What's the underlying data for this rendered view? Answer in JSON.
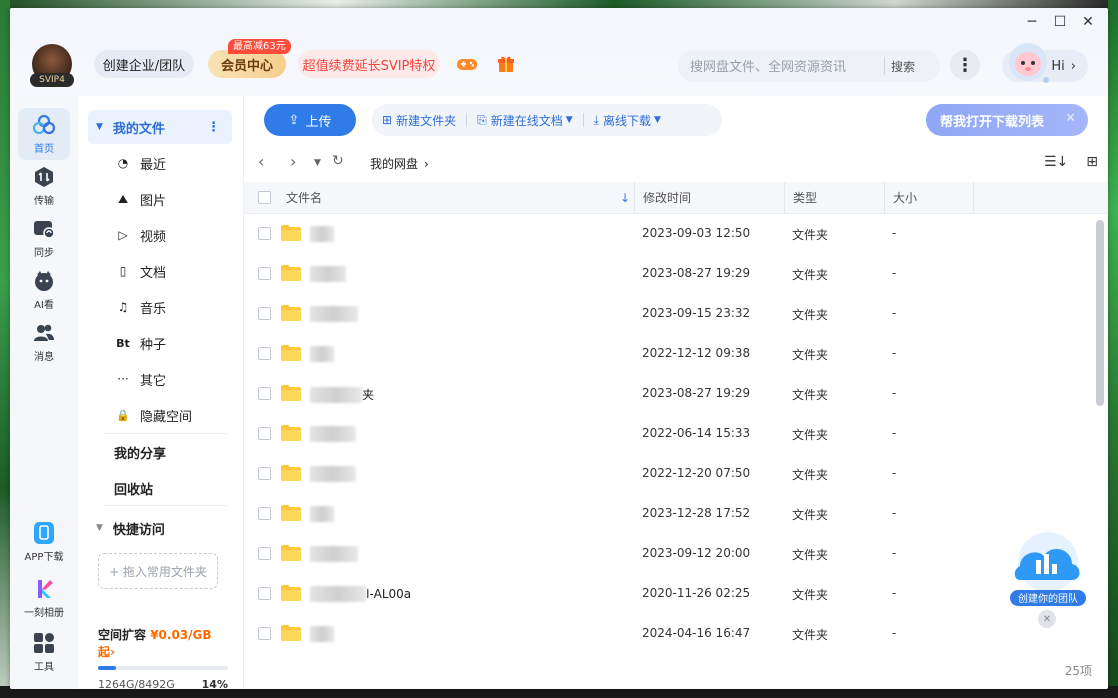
{
  "window": {
    "minimize": "─",
    "maximize": "☐",
    "close": "✕"
  },
  "header": {
    "svip_tag": "SVIP4",
    "enterprise_btn": "创建企业/团队",
    "vip_center": "会员中心",
    "vip_badge": "最高减63元",
    "renew_promo": "超值续费延长SVIP特权",
    "search_placeholder": "搜网盘文件、全网资源资讯",
    "search_btn": "搜索",
    "hi": "Hi"
  },
  "leftnav": [
    {
      "label": "首页",
      "icon": "cloud-home-icon",
      "active": true
    },
    {
      "label": "传输",
      "icon": "transfer-icon",
      "active": false
    },
    {
      "label": "同步",
      "icon": "sync-icon",
      "active": false
    },
    {
      "label": "AI看",
      "icon": "ai-look-icon",
      "active": false
    },
    {
      "label": "消息",
      "icon": "message-icon",
      "active": false
    }
  ],
  "leftnav_bottom": [
    {
      "label": "APP下载",
      "icon": "app-download-icon"
    },
    {
      "label": "一刻相册",
      "icon": "album-icon"
    },
    {
      "label": "工具",
      "icon": "tools-icon"
    }
  ],
  "side": {
    "my_files": "我的文件",
    "items": [
      {
        "label": "最近",
        "icon": "clock-icon",
        "glyph": "◔"
      },
      {
        "label": "图片",
        "icon": "image-icon",
        "glyph": "⛰"
      },
      {
        "label": "视频",
        "icon": "video-icon",
        "glyph": "▷"
      },
      {
        "label": "文档",
        "icon": "document-icon",
        "glyph": "▯"
      },
      {
        "label": "音乐",
        "icon": "headphones-icon",
        "glyph": "♫"
      },
      {
        "label": "种子",
        "icon": "bt-icon",
        "glyph": "Bt"
      },
      {
        "label": "其它",
        "icon": "more-dots-icon",
        "glyph": "···"
      },
      {
        "label": "隐藏空间",
        "icon": "lock-icon",
        "glyph": "🔒"
      }
    ],
    "my_share": "我的分享",
    "recycle": "回收站",
    "quick_access": "快捷访问",
    "quick_drop": "+ 拖入常用文件夹",
    "storage_title": "空间扩容",
    "storage_price": "¥0.03/GB起",
    "storage_used": "1264G/8492G",
    "storage_pct": "14%",
    "storage_fraction": 0.14
  },
  "toolbar": {
    "upload": "上传",
    "new_folder": "新建文件夹",
    "new_doc": "新建在线文档",
    "offline_dl": "离线下载",
    "open_dl_list": "帮我打开下载列表"
  },
  "path": {
    "crumb": "我的网盘"
  },
  "columns": {
    "name": "文件名",
    "modified": "修改时间",
    "type": "类型",
    "size": "大小"
  },
  "files": [
    {
      "name": "",
      "blur_w": 24,
      "suffix": "",
      "modified": "2023-09-03 12:50",
      "type": "文件夹",
      "size": "-"
    },
    {
      "name": "",
      "blur_w": 36,
      "suffix": "",
      "modified": "2023-08-27 19:29",
      "type": "文件夹",
      "size": "-"
    },
    {
      "name": "",
      "blur_w": 48,
      "suffix": "",
      "modified": "2023-09-15 23:32",
      "type": "文件夹",
      "size": "-"
    },
    {
      "name": "",
      "blur_w": 24,
      "suffix": "",
      "modified": "2022-12-12 09:38",
      "type": "文件夹",
      "size": "-"
    },
    {
      "name": "",
      "blur_w": 52,
      "suffix": "夹",
      "modified": "2023-08-27 19:29",
      "type": "文件夹",
      "size": "-"
    },
    {
      "name": "",
      "blur_w": 46,
      "suffix": "",
      "modified": "2022-06-14 15:33",
      "type": "文件夹",
      "size": "-"
    },
    {
      "name": "",
      "blur_w": 46,
      "suffix": "",
      "modified": "2022-12-20 07:50",
      "type": "文件夹",
      "size": "-"
    },
    {
      "name": "",
      "blur_w": 24,
      "suffix": "",
      "modified": "2023-12-28 17:52",
      "type": "文件夹",
      "size": "-"
    },
    {
      "name": "",
      "blur_w": 48,
      "suffix": "",
      "modified": "2023-09-12 20:00",
      "type": "文件夹",
      "size": "-"
    },
    {
      "name": "",
      "blur_w": 56,
      "suffix": "I-AL00a",
      "modified": "2020-11-26 02:25",
      "type": "文件夹",
      "size": "-"
    },
    {
      "name": "",
      "blur_w": 24,
      "suffix": "",
      "modified": "2024-04-16 16:47",
      "type": "文件夹",
      "size": "-"
    }
  ],
  "footer": {
    "count": "25项"
  },
  "team_float": {
    "label": "创建你的团队"
  }
}
